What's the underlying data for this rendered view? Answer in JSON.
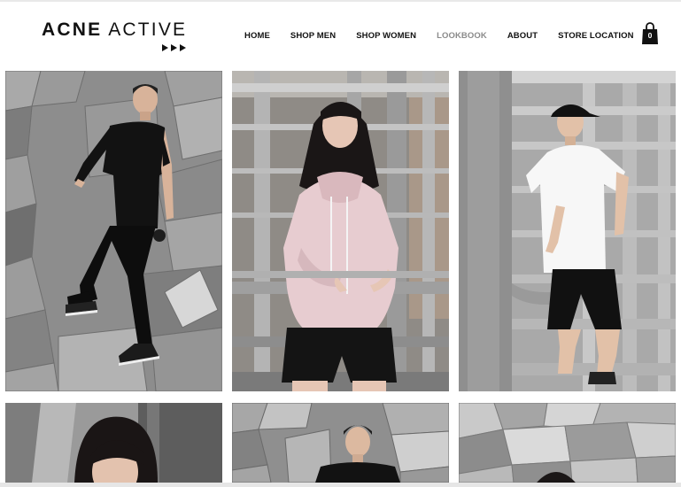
{
  "brand": {
    "name_bold": "ACNE",
    "name_light": "ACTIVE",
    "logo_arrows_icon": "triple-play-arrows-icon"
  },
  "nav": {
    "items": [
      {
        "label": "HOME"
      },
      {
        "label": "SHOP MEN"
      },
      {
        "label": "SHOP WOMEN"
      },
      {
        "label": "LOOKBOOK",
        "active": true
      },
      {
        "label": "ABOUT"
      },
      {
        "label": "STORE LOCATION"
      }
    ],
    "active_color": "#8a8a8a"
  },
  "cart": {
    "icon": "shopping-bag-icon",
    "count": "0"
  },
  "gallery": {
    "photos": [
      "lookbook-photo-man-black-outfit-on-tiled-wall",
      "lookbook-photo-woman-pink-hoodie-by-railings",
      "lookbook-photo-man-white-tee-black-cap-by-railings",
      "lookbook-photo-woman-partial",
      "lookbook-photo-man-partial",
      "lookbook-photo-geometric-wall-partial"
    ]
  },
  "colors": {
    "text": "#111111",
    "background": "#ffffff"
  }
}
